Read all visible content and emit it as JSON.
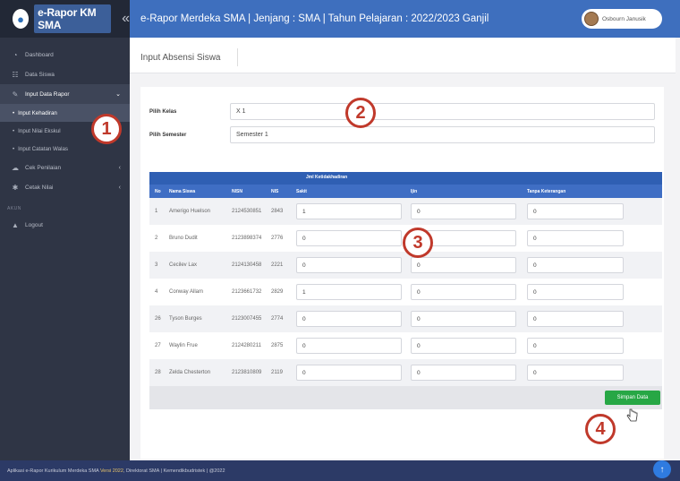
{
  "brand": {
    "logo_icon": "school-logo-icon",
    "name": "e-Rapor KM SMA",
    "collapse": "«"
  },
  "sidebar": {
    "items": [
      {
        "icon": "dashboard-icon",
        "glyph": "◔",
        "label": "Dashboard"
      },
      {
        "icon": "users-icon",
        "glyph": "☷",
        "label": "Data Siswa"
      },
      {
        "icon": "edit-icon",
        "glyph": "✎",
        "label": "Input Data Rapor",
        "caret": "⌄"
      }
    ],
    "subitems": [
      {
        "label": "Input Kehadiran"
      },
      {
        "label": "Input Nilai Ekskul"
      },
      {
        "label": "Input Catatan Walas"
      }
    ],
    "items2": [
      {
        "icon": "cloud-icon",
        "glyph": "☁",
        "label": "Cek Penilaian",
        "caret": "‹"
      },
      {
        "icon": "gear-icon",
        "glyph": "✱",
        "label": "Cetak Nilai",
        "caret": "‹"
      }
    ],
    "section": "AKUN",
    "logout": {
      "icon": "logout-icon",
      "glyph": "▲",
      "label": "Logout"
    }
  },
  "topbar": {
    "title": "e-Rapor Merdeka SMA | Jenjang : SMA | Tahun Pelajaran : 2022/2023 Ganjil",
    "user_name": "Osbourn Janusik"
  },
  "page": {
    "title": "Input Absensi Siswa"
  },
  "form": {
    "kelas_label": "Pilih Kelas",
    "kelas_value": "X 1",
    "semester_label": "Pilih Semester",
    "semester_value": "Semester 1"
  },
  "table": {
    "group_header": "Jml Ketidakhadiran",
    "headers": {
      "no": "No",
      "nama": "Nama Siswa",
      "nisn": "NISN",
      "nis": "NIS",
      "sakit": "Sakit",
      "izin": "Ijin",
      "tanpa": "Tanpa Keterangan"
    },
    "rows": [
      {
        "no": "1",
        "nama": "Amerigo Huelson",
        "nisn": "2124530851",
        "nis": "2843",
        "sakit": "1",
        "izin": "0",
        "tanpa": "0"
      },
      {
        "no": "2",
        "nama": "Bruno Dudit",
        "nisn": "2123898374",
        "nis": "2776",
        "sakit": "0",
        "izin": "0",
        "tanpa": "0"
      },
      {
        "no": "3",
        "nama": "Cecilev Lax",
        "nisn": "2124130458",
        "nis": "2221",
        "sakit": "0",
        "izin": "0",
        "tanpa": "0"
      },
      {
        "no": "4",
        "nama": "Conway Allam",
        "nisn": "2123661732",
        "nis": "2829",
        "sakit": "1",
        "izin": "0",
        "tanpa": "0"
      },
      {
        "no": "26",
        "nama": "Tyson Burges",
        "nisn": "2123007455",
        "nis": "2774",
        "sakit": "0",
        "izin": "0",
        "tanpa": "0"
      },
      {
        "no": "27",
        "nama": "Waylin Frue",
        "nisn": "2124280211",
        "nis": "2875",
        "sakit": "0",
        "izin": "0",
        "tanpa": "0"
      },
      {
        "no": "28",
        "nama": "Zelda Chesterton",
        "nisn": "2123810809",
        "nis": "2119",
        "sakit": "0",
        "izin": "0",
        "tanpa": "0"
      }
    ],
    "save_label": "Simpan Data"
  },
  "annotations": {
    "b1": "1",
    "b2": "2",
    "b3": "3",
    "b4": "4"
  },
  "footer": {
    "text_a": "Aplikasi e-Rapor Kurikulum Merdeka SMA",
    "text_b": "Versi 2022",
    "text_c": ", Direktorat SMA | Kemendikbudristek | @2022",
    "scroll_icon": "arrow-up-icon"
  },
  "colors": {
    "accent": "#3e6fbe",
    "sidebar": "#2f3545",
    "annotation": "#c0392b",
    "save": "#27a745"
  }
}
